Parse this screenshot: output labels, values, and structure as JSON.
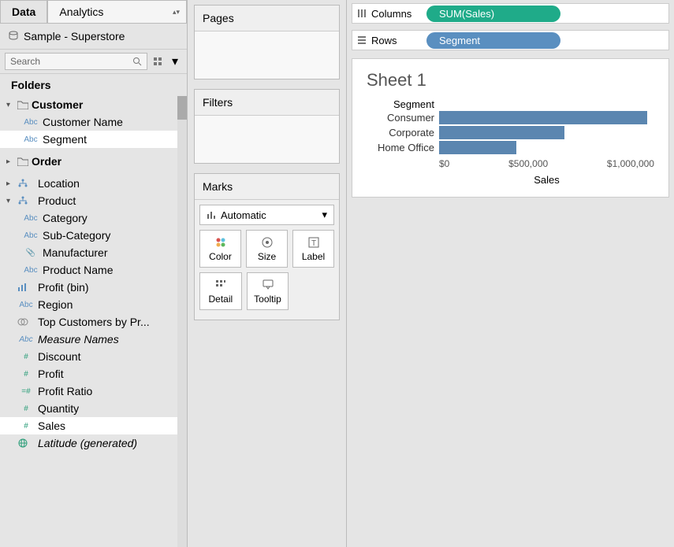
{
  "tabs": {
    "data": "Data",
    "analytics": "Analytics"
  },
  "datasource": "Sample - Superstore",
  "search": {
    "placeholder": "Search"
  },
  "folders_header": "Folders",
  "tree": {
    "customer": "Customer",
    "customer_name": "Customer Name",
    "segment": "Segment",
    "order": "Order",
    "location": "Location",
    "product": "Product",
    "category": "Category",
    "sub_category": "Sub-Category",
    "manufacturer": "Manufacturer",
    "product_name": "Product Name",
    "profit_bin": "Profit (bin)",
    "region": "Region",
    "top_customers": "Top Customers by Pr...",
    "measure_names": "Measure Names",
    "discount": "Discount",
    "profit": "Profit",
    "profit_ratio": "Profit Ratio",
    "quantity": "Quantity",
    "sales": "Sales",
    "latitude": "Latitude (generated)"
  },
  "cards": {
    "pages": "Pages",
    "filters": "Filters",
    "marks": "Marks"
  },
  "marks": {
    "type": "Automatic",
    "color": "Color",
    "size": "Size",
    "label": "Label",
    "detail": "Detail",
    "tooltip": "Tooltip"
  },
  "shelves": {
    "columns": "Columns",
    "columns_pill": "SUM(Sales)",
    "rows": "Rows",
    "rows_pill": "Segment"
  },
  "sheet_title": "Sheet 1",
  "chart_data": {
    "type": "bar",
    "title": "Sheet 1",
    "y_header": "Segment",
    "categories": [
      "Consumer",
      "Corporate",
      "Home Office"
    ],
    "values": [
      1160000,
      700000,
      430000
    ],
    "xlabel": "Sales",
    "xlim": [
      0,
      1200000
    ],
    "ticks": [
      "$0",
      "$500,000",
      "$1,000,000"
    ]
  }
}
